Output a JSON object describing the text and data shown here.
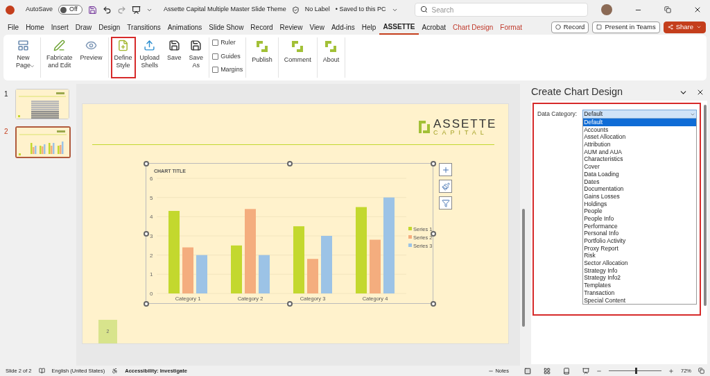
{
  "title_bar": {
    "autosave_label": "AutoSave",
    "autosave": {
      "on": false,
      "label": "Off"
    },
    "document_title": "Assette Capital Multiple Master Slide Theme",
    "label_status": "No Label",
    "save_status": "• Saved to this PC",
    "search": {
      "placeholder": "Search"
    }
  },
  "menu_tabs": [
    {
      "label": "File",
      "selected": false,
      "contextual": false
    },
    {
      "label": "Home",
      "selected": false,
      "contextual": false
    },
    {
      "label": "Insert",
      "selected": false,
      "contextual": false
    },
    {
      "label": "Draw",
      "selected": false,
      "contextual": false
    },
    {
      "label": "Design",
      "selected": false,
      "contextual": false
    },
    {
      "label": "Transitions",
      "selected": false,
      "contextual": false
    },
    {
      "label": "Animations",
      "selected": false,
      "contextual": false
    },
    {
      "label": "Slide Show",
      "selected": false,
      "contextual": false
    },
    {
      "label": "Record",
      "selected": false,
      "contextual": false
    },
    {
      "label": "Review",
      "selected": false,
      "contextual": false
    },
    {
      "label": "View",
      "selected": false,
      "contextual": false
    },
    {
      "label": "Add-ins",
      "selected": false,
      "contextual": false
    },
    {
      "label": "Help",
      "selected": false,
      "contextual": false
    },
    {
      "label": "ASSETTE",
      "selected": true,
      "contextual": false
    },
    {
      "label": "Acrobat",
      "selected": false,
      "contextual": false
    },
    {
      "label": "Chart Design",
      "selected": false,
      "contextual": true
    },
    {
      "label": "Format",
      "selected": false,
      "contextual": true
    }
  ],
  "header_buttons": [
    {
      "label": "Record"
    },
    {
      "label": "Present in Teams"
    },
    {
      "label": "Share"
    }
  ],
  "ribbon_groups": [
    {
      "items": [
        {
          "kind": "button",
          "label": "New\nPage",
          "dropdown": true,
          "highlighted": false
        }
      ]
    },
    {
      "items": [
        {
          "kind": "button",
          "label": "Fabricate\nand Edit",
          "dropdown": false,
          "highlighted": false
        },
        {
          "kind": "button",
          "label": "Preview",
          "dropdown": false,
          "highlighted": false
        }
      ]
    },
    {
      "items": [
        {
          "kind": "button",
          "label": "Define\nStyle",
          "dropdown": false,
          "highlighted": true
        },
        {
          "kind": "button",
          "label": "Upload\nShells",
          "dropdown": false,
          "highlighted": false
        },
        {
          "kind": "button",
          "label": "Save",
          "dropdown": false,
          "highlighted": false
        },
        {
          "kind": "button",
          "label": "Save\nAs",
          "dropdown": false,
          "highlighted": false
        }
      ]
    },
    {
      "items": [
        {
          "kind": "checkbox",
          "label": "Ruler",
          "checked": false
        },
        {
          "kind": "checkbox",
          "label": "Guides",
          "checked": false
        },
        {
          "kind": "checkbox",
          "label": "Margins",
          "checked": false
        }
      ]
    },
    {
      "items": [
        {
          "kind": "button",
          "label": "Publish",
          "dropdown": false,
          "highlighted": false
        }
      ]
    },
    {
      "items": [
        {
          "kind": "button",
          "label": "Comment",
          "dropdown": false,
          "highlighted": false
        }
      ]
    },
    {
      "items": [
        {
          "kind": "button",
          "label": "About",
          "dropdown": false,
          "highlighted": false
        }
      ]
    }
  ],
  "thumbnails": [
    {
      "number": "1",
      "selected": false,
      "kind": "table"
    },
    {
      "number": "2",
      "selected": true,
      "kind": "chart"
    }
  ],
  "slide": {
    "logo_top": "ASSETTE",
    "logo_bottom": "CAPITAL",
    "slide_number": "2",
    "chart_data": {
      "type": "bar",
      "title": "CHART TITLE",
      "categories": [
        "Category 1",
        "Category 2",
        "Category 3",
        "Category 4"
      ],
      "series": [
        {
          "name": "Series 1",
          "color": "#c3d82e",
          "values": [
            4.3,
            2.5,
            3.5,
            4.5
          ]
        },
        {
          "name": "Series 2",
          "color": "#f4ad7e",
          "values": [
            2.4,
            4.4,
            1.8,
            2.8
          ]
        },
        {
          "name": "Series 3",
          "color": "#9cc3e6",
          "values": [
            2,
            2,
            3,
            5
          ]
        }
      ],
      "ylim": [
        0,
        6
      ],
      "yticks": [
        0,
        1,
        2,
        3,
        4,
        5,
        6
      ],
      "grid": true,
      "legend": "right"
    }
  },
  "pane": {
    "title": "Create Chart Design",
    "highlighted": true,
    "field_label": "Data Category:",
    "value": "Default",
    "options": [
      {
        "label": "Default",
        "selected": true
      },
      {
        "label": "Accounts",
        "selected": false
      },
      {
        "label": "Asset Allocation",
        "selected": false
      },
      {
        "label": "Attribution",
        "selected": false
      },
      {
        "label": "AUM and AUA",
        "selected": false
      },
      {
        "label": "Characteristics",
        "selected": false
      },
      {
        "label": "Cover",
        "selected": false
      },
      {
        "label": "Data Loading",
        "selected": false
      },
      {
        "label": "Dates",
        "selected": false
      },
      {
        "label": "Documentation",
        "selected": false
      },
      {
        "label": "Gains Losses",
        "selected": false
      },
      {
        "label": "Holdings",
        "selected": false
      },
      {
        "label": "People",
        "selected": false
      },
      {
        "label": "People Info",
        "selected": false
      },
      {
        "label": "Performance",
        "selected": false
      },
      {
        "label": "Personal Info",
        "selected": false
      },
      {
        "label": "Portfolio Activity",
        "selected": false
      },
      {
        "label": "Proxy Report",
        "selected": false
      },
      {
        "label": "Risk",
        "selected": false
      },
      {
        "label": "Sector Allocation",
        "selected": false
      },
      {
        "label": "Strategy Info",
        "selected": false
      },
      {
        "label": "Strategy Info2",
        "selected": false
      },
      {
        "label": "Templates",
        "selected": false
      },
      {
        "label": "Transaction",
        "selected": false
      },
      {
        "label": "Special Content",
        "selected": false
      }
    ]
  },
  "status_bar": {
    "slide": "Slide 2 of 2",
    "language": "English (United States)",
    "accessibility": "Accessibility: Investigate",
    "notes": "Notes",
    "zoom": {
      "level": 0.5,
      "label": "72%"
    }
  }
}
